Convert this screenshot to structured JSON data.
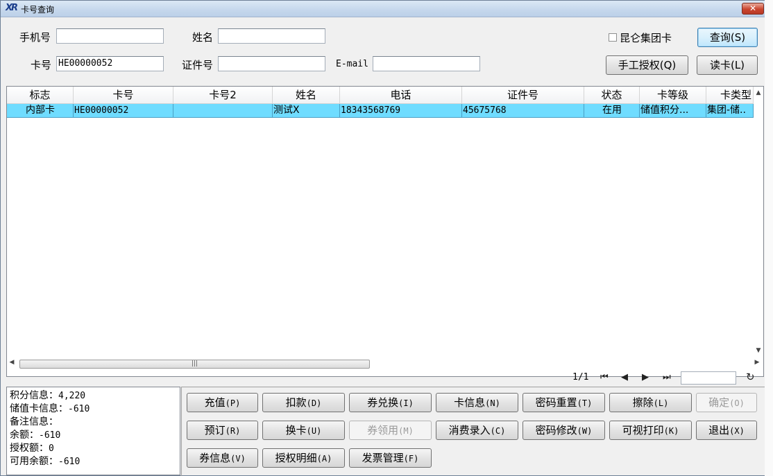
{
  "window": {
    "title": "卡号查询",
    "app_icon": "XR",
    "close_label": "✕"
  },
  "search": {
    "phone_label": "手机号",
    "phone_value": "",
    "name_label": "姓名",
    "name_value": "",
    "card_label": "卡号",
    "card_value": "HE00000052",
    "id_label": "证件号",
    "id_value": "",
    "email_label": "E-mail",
    "email_value": "",
    "group_card_label": "昆仑集团卡",
    "group_card_checked": false,
    "query_button": "查询(S)",
    "manual_auth_button": "手工授权(Q)",
    "read_card_button": "读卡(L)"
  },
  "grid": {
    "columns": [
      "标志",
      "卡号",
      "卡号2",
      "姓名",
      "电话",
      "证件号",
      "状态",
      "卡等级",
      "卡类型"
    ],
    "rows": [
      {
        "flag": "内部卡",
        "card_no": "HE00000052",
        "card_no2": "",
        "name": "测试X",
        "phone": "18343568769",
        "id_no": "45675768",
        "status": "在用",
        "level": "储值积分...",
        "type": "集团-储.."
      }
    ],
    "selected_row_color": "#6fdcff"
  },
  "pager": {
    "page": "1/1",
    "jump_value": ""
  },
  "info": [
    {
      "label": "积分信息：",
      "value": "4,220"
    },
    {
      "label": "储值卡信息：",
      "value": "-610"
    },
    {
      "label": "备注信息：",
      "value": ""
    },
    {
      "label": "余额：",
      "value": "-610"
    },
    {
      "label": "授权额：",
      "value": "0"
    },
    {
      "label": "可用余额：",
      "value": "-610"
    }
  ],
  "actions": [
    {
      "text": "充值",
      "key": "(P)"
    },
    {
      "text": "扣款",
      "key": "(D)"
    },
    {
      "text": "券兑换",
      "key": "(I)"
    },
    {
      "text": "卡信息",
      "key": "(N)"
    },
    {
      "text": "密码重置",
      "key": "(T)"
    },
    {
      "text": "擦除",
      "key": "(L)"
    },
    {
      "text": "确定",
      "key": "(O)"
    },
    {
      "text": "预订",
      "key": "(R)"
    },
    {
      "text": "换卡",
      "key": "(U)"
    },
    {
      "text": "券领用",
      "key": "(M)"
    },
    {
      "text": "消费录入",
      "key": "(C)"
    },
    {
      "text": "密码修改",
      "key": "(W)"
    },
    {
      "text": "可视打印",
      "key": "(K)"
    },
    {
      "text": "退出",
      "key": "(X)"
    },
    {
      "text": "券信息",
      "key": "(V)"
    },
    {
      "text": "授权明细",
      "key": "(A)"
    },
    {
      "text": "发票管理",
      "key": "(F)"
    }
  ]
}
